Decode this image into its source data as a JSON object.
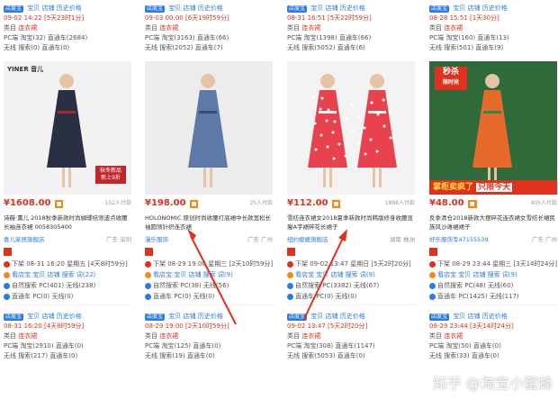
{
  "columns": [
    {
      "tools": [
        "店度宝",
        "宝贝",
        "店铺",
        "历史价格"
      ],
      "top_time": "09-02 14:22 [5天23时1分]",
      "category_label": "类目",
      "category_value": "连衣裙",
      "pc_row": "PC端  淘宝(32)  直通车(2684)",
      "wireless_row": "无线  搜索(0)  直通车(0)",
      "price": "¥1608.00",
      "paid": "152人付款",
      "title": "诗薇·薰儿 2018秋季新款时尚蝴蝶结领波点收腰长袖连衣裙 0058305400",
      "shop": "喜儿家居旗舰店",
      "location": "广东 深圳",
      "down_time": "下架 08-31 16:20 星期五 [4天8时59分]",
      "s1": "看店宝 宝贝 店铺 搜索 词(22)",
      "s2": "自然搜索 PC(401) 无线(238)",
      "s3": "直通车 PC(0) 无线(0)",
      "lower_time": "08-31 16:20 [4天8时59分]",
      "lower_pc": "PC端  淘宝(2910)  直通车(0)",
      "lower_wireless": "无线  搜索(217)  直通车(0)"
    },
    {
      "tools": [
        "店度宝",
        "宝贝",
        "店铺",
        "历史价格"
      ],
      "top_time": "09-03 00:00 [6天19时59分]",
      "category_label": "类目",
      "category_value": "连衣裙",
      "pc_row": "PC端  淘宝(3163)  直通车(66)",
      "wireless_row": "无线  搜索(2052)  直通车(7)",
      "price": "¥198.00",
      "paid": "25人付款",
      "title": "HOLONOMIC 原创时尚收腰打底裙中长款宽松长袖圆领针织连衣裙",
      "shop": "漫乐服饰",
      "location": "广东 广州",
      "down_time": "下架 08-29 19:00 星期三 [2天10时59分]",
      "s1": "看店宝 宝贝 店铺 搜索 词(9)",
      "s2": "自然搜索 PC(38) 无线(56)",
      "s3": "直通车 PC(0) 无线(0)",
      "lower_time": "08-29 19:00 [2天10时59分]",
      "lower_pc": "PC端  淘宝(125)  直通车(0)",
      "lower_wireless": "无线  搜索(19)  直通车(0)"
    },
    {
      "tools": [
        "店度宝",
        "宝贝",
        "店铺",
        "历史价格"
      ],
      "top_time": "08-31 16:51 [5天22时59分]",
      "category_label": "类目",
      "category_value": "连衣裙",
      "pc_row": "PC端  淘宝(1398)  直通车(66)",
      "wireless_row": "无线  搜索(5052)  直通车(6)",
      "price": "¥112.00",
      "paid": "1898人付款",
      "title": "雪纺连衣裙女2018夏季新款时尚韩版修身收腰显瘦A字裙碎花长裙子",
      "shop": "纽约嬷嬷旗舰店",
      "location": "湖南 株洲",
      "down_time": "下架 09-02 13:47 星期日 [5天2时20分]",
      "s1": "看店宝 宝贝 店铺 搜索 词(9)",
      "s2": "自然搜索 PC(3382) 无线(67)",
      "s3": "直通车 PC(0) 无线(0)",
      "lower_time": "09-02 13:47 [5天2时20分]",
      "lower_pc": "PC端  淘宝(308)  直通车(1147)",
      "lower_wireless": "无线  搜索(5053)  直通车(0)"
    },
    {
      "tools": [
        "店度宝",
        "宝贝",
        "店铺",
        "历史价格"
      ],
      "top_time": "08-28 15:51 [1天30分]",
      "category_label": "类目",
      "category_value": "连衣裙",
      "pc_row": "PC端  淘宝(160)  直通车(13)",
      "wireless_row": "无线  搜索(501)  直通车(9)",
      "price": "¥48.00",
      "paid": "405人付款",
      "title": "反季清仓2018新款大摆碎花连衣裙女雪纺长裙民族风沙滩裙裙子",
      "shop": "好乐服饰专47155539",
      "location": "广东 广州",
      "down_time": "下架 08-29 23:44 星期三 [3天14时24分]",
      "s1": "看店宝 宝贝 店铺 搜索 词(9)",
      "s2": "自然搜索 PC(48) 无线(60)",
      "s3": "直通车 PC(1425) 无线(117)",
      "lower_time": "08-29 23:44 [3天14时24分]",
      "lower_pc": "PC端  淘宝(50)  直通车(0)",
      "lower_wireless": "无线  搜索(33)  直通车(0)"
    }
  ],
  "promo": {
    "flash_sale": "秒杀",
    "flash_sub": "限时抢",
    "banner_left": "掌柜卖疯了",
    "banner_right": "只限今天"
  },
  "brand_logo": "YINER 音儿",
  "col1_overlay": "秋冬新品 新上9折",
  "watermark": "知乎 @淘宝小蜜蜂",
  "colors": {
    "accent_blue": "#2c7be5",
    "price_red": "#e0301e",
    "badge_orange": "#f08a1d",
    "arrow_red": "#e0301e"
  }
}
